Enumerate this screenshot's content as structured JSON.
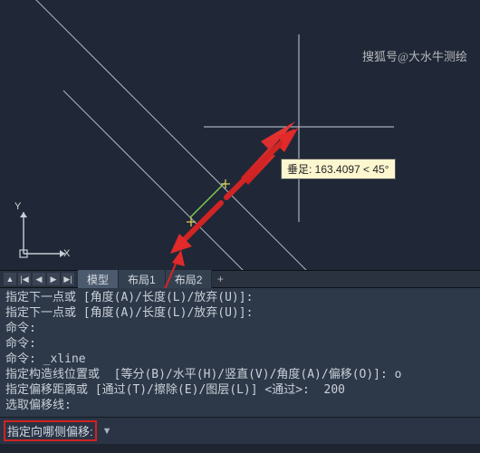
{
  "watermark": "搜狐号@大水牛测绘",
  "tooltip": {
    "text": "垂足: 163.4097 < 45°"
  },
  "ucs": {
    "x_label": "X",
    "y_label": "Y"
  },
  "layout_tabs": {
    "model": "模型",
    "layout1": "布局1",
    "layout2": "布局2",
    "add": "+"
  },
  "cmd_history": [
    "指定下一点或 [角度(A)/长度(L)/放弃(U)]:",
    "指定下一点或 [角度(A)/长度(L)/放弃(U)]:",
    "命令:",
    "命令:",
    "命令: _xline",
    "指定构造线位置或  [等分(B)/水平(H)/竖直(V)/角度(A)/偏移(O)]: o",
    "指定偏移距离或 [通过(T)/擦除(E)/图层(L)] <通过>:  200",
    "选取偏移线:"
  ],
  "cmd_prompt": "指定向哪侧偏移:",
  "colors": {
    "viewport_bg": "#202838",
    "red_arrow": "#d22222",
    "tooltip_bg": "#fdf7d0"
  },
  "chart_data": null
}
